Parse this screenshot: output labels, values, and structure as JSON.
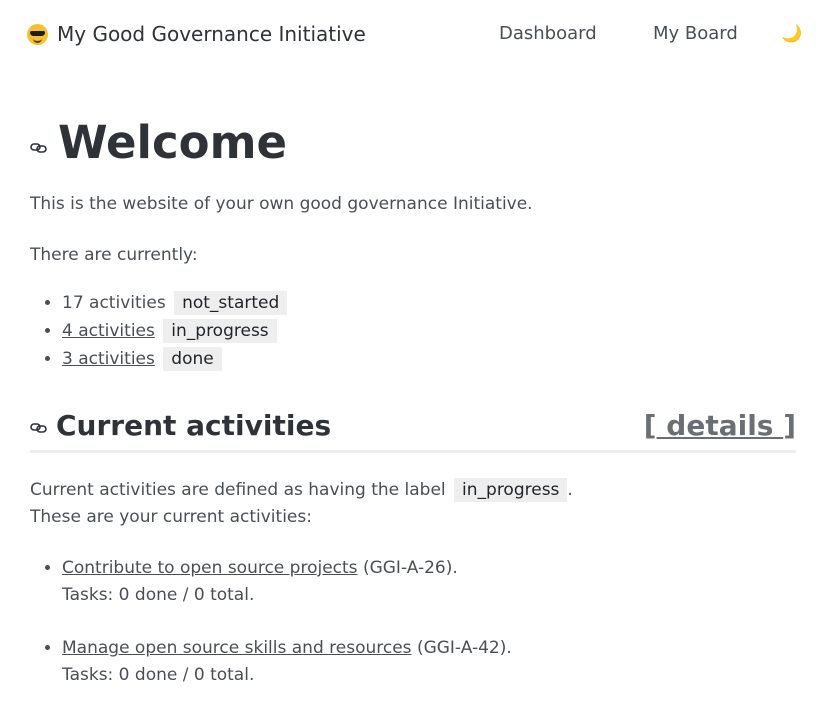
{
  "header": {
    "brand_title": "My Good Governance Initiative",
    "brand_icon": "sunglasses-smiley-icon",
    "nav": {
      "dashboard": "Dashboard",
      "board": "My Board"
    },
    "theme_icon": "moon-icon",
    "theme_glyph": "🌙"
  },
  "welcome": {
    "title": "Welcome",
    "intro": "This is the website of your own good governance Initiative.",
    "currently": "There are currently:",
    "stats": [
      {
        "count_text": "17 activities",
        "label": "not_started",
        "linked": false
      },
      {
        "count_text": "4 activities",
        "label": "in_progress",
        "linked": true
      },
      {
        "count_text": "3 activities",
        "label": "done",
        "linked": true
      }
    ]
  },
  "current": {
    "title": "Current activities",
    "details_label": "[ details ]",
    "details_text": " details ",
    "definition_prefix": "Current activities are defined as having the label",
    "definition_label": "in_progress",
    "definition_suffix": ".",
    "list_intro": "These are your current activities:",
    "activities": [
      {
        "name": "Contribute to open source projects",
        "id": "(GGI-A-26).",
        "tasks": "Tasks: 0 done / 0 total."
      },
      {
        "name": "Manage open source skills and resources",
        "id": "(GGI-A-42).",
        "tasks": "Tasks: 0 done / 0 total."
      }
    ]
  },
  "colors": {
    "text": "#4a4f55",
    "heading": "#2f3338",
    "code_bg": "#eeeeee",
    "emoji": "#f6c02f"
  }
}
